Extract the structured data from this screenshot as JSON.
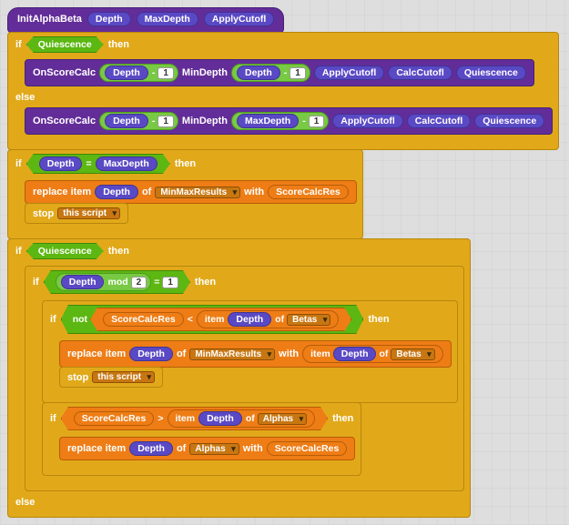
{
  "hat": {
    "name": "InitAlphaBeta",
    "p1": "Depth",
    "p2": "MaxDepth",
    "p3": "ApplyCutofl"
  },
  "kw": {
    "if": "if",
    "then": "then",
    "else": "else",
    "not": "not",
    "replace_item": "replace  item",
    "of": "of",
    "with": "with",
    "item": "item",
    "stop": "stop",
    "mod": "mod",
    "minus": "-",
    "lt": "<",
    "gt": ">",
    "eq": "="
  },
  "vars": {
    "Quiescence": "Quiescence",
    "Depth": "Depth",
    "MaxDepth": "MaxDepth",
    "OnScoreCalc": "OnScoreCalc",
    "MinDepth": "MinDepth",
    "ApplyCutofl": "ApplyCutofl",
    "CalcCutofl": "CalcCutofl",
    "ScoreCalcRes": "ScoreCalcRes"
  },
  "nums": {
    "one": "1",
    "two": "2"
  },
  "dd": {
    "MinMaxResults": "MinMaxResults",
    "this_script": "this script",
    "Betas": "Betas",
    "Alphas": "Alphas"
  }
}
